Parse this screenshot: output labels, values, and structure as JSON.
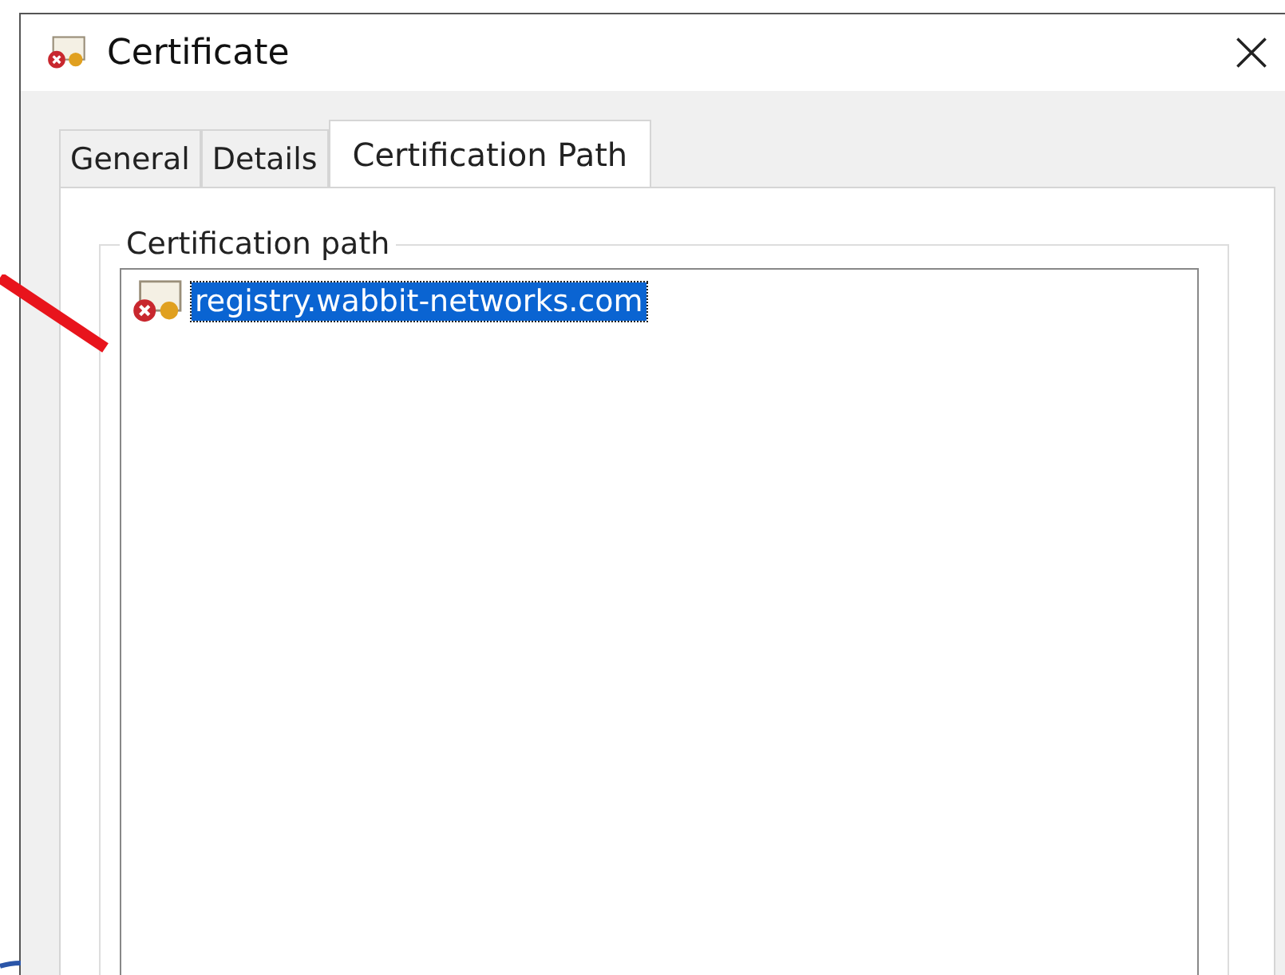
{
  "window": {
    "title": "Certificate"
  },
  "tabs": [
    {
      "label": "General",
      "selected": false
    },
    {
      "label": "Details",
      "selected": false
    },
    {
      "label": "Certification Path",
      "selected": true
    }
  ],
  "group": {
    "label": "Certification path"
  },
  "tree": [
    {
      "label": "registry.wabbit-networks.com",
      "selected": true,
      "kind": "error"
    }
  ]
}
